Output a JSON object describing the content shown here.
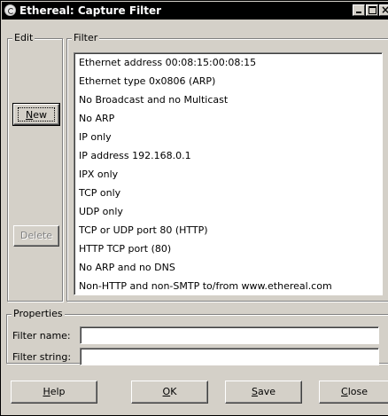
{
  "window": {
    "title": "Ethereal: Capture Filter"
  },
  "edit_group": {
    "label": "Edit",
    "new_button": {
      "mnemonic": "N",
      "rest": "ew"
    },
    "delete_button": {
      "label": "Delete",
      "enabled": false
    }
  },
  "filter_group": {
    "label": "Filter",
    "items": [
      "Ethernet address 00:08:15:00:08:15",
      "Ethernet type 0x0806 (ARP)",
      "No Broadcast and no Multicast",
      "No ARP",
      "IP only",
      "IP address 192.168.0.1",
      "IPX only",
      "TCP only",
      "UDP only",
      "TCP or UDP port 80 (HTTP)",
      "HTTP TCP port (80)",
      "No ARP and no DNS",
      "Non-HTTP and non-SMTP to/from www.ethereal.com"
    ]
  },
  "properties_group": {
    "label": "Properties",
    "filter_name": {
      "label": "Filter name:",
      "value": ""
    },
    "filter_string": {
      "label": "Filter string:",
      "value": ""
    }
  },
  "buttons": {
    "help": {
      "mnemonic": "H",
      "rest": "elp"
    },
    "ok": {
      "mnemonic": "O",
      "rest": "K"
    },
    "save": {
      "mnemonic": "S",
      "rest": "ave"
    },
    "close": {
      "mnemonic": "C",
      "rest": "lose"
    }
  }
}
